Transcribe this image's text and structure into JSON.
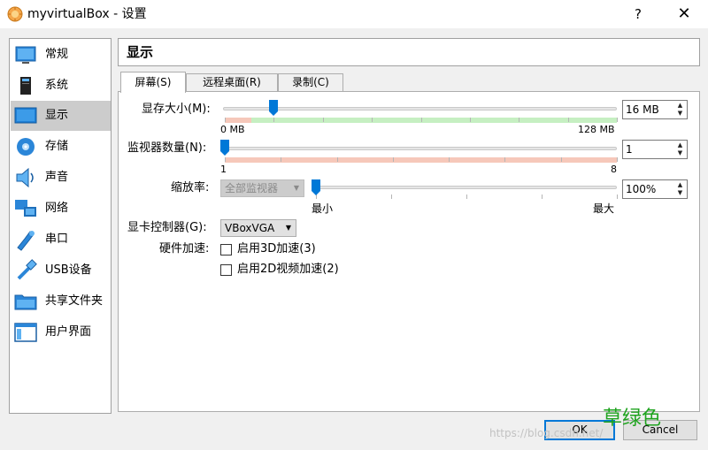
{
  "window": {
    "title": "myvirtualBox - 设置",
    "help_label": "?",
    "close_label": "✕"
  },
  "sidebar": {
    "items": [
      {
        "label": "常规",
        "icon": "general-icon"
      },
      {
        "label": "系统",
        "icon": "system-icon"
      },
      {
        "label": "显示",
        "icon": "display-icon",
        "active": true
      },
      {
        "label": "存储",
        "icon": "storage-icon"
      },
      {
        "label": "声音",
        "icon": "audio-icon"
      },
      {
        "label": "网络",
        "icon": "network-icon"
      },
      {
        "label": "串口",
        "icon": "serial-port-icon"
      },
      {
        "label": "USB设备",
        "icon": "usb-icon"
      },
      {
        "label": "共享文件夹",
        "icon": "shared-folder-icon"
      },
      {
        "label": "用户界面",
        "icon": "user-interface-icon"
      }
    ]
  },
  "section": {
    "title": "显示"
  },
  "tabs": [
    {
      "label": "屏幕(S)",
      "active": true
    },
    {
      "label": "远程桌面(R)",
      "active": false
    },
    {
      "label": "录制(C)",
      "active": false
    }
  ],
  "screen": {
    "video_memory": {
      "label": "显存大小(M):",
      "min_label": "0 MB",
      "max_label": "128 MB",
      "value": "16 MB",
      "slider_value": 16,
      "slider_max": 128
    },
    "monitor_count": {
      "label": "监视器数量(N):",
      "min_label": "1",
      "max_label": "8",
      "value": "1",
      "slider_value": 1,
      "slider_min": 1,
      "slider_max": 8
    },
    "scale_factor": {
      "label": "缩放率:",
      "monitor_select": "全部监视器",
      "min_label": "最小",
      "max_label": "最大",
      "value": "100%"
    },
    "graphics_controller": {
      "label": "显卡控制器(G):",
      "value": "VBoxVGA"
    },
    "acceleration": {
      "label": "硬件加速:",
      "enable_3d": {
        "label": "启用3D加速(3)",
        "checked": false
      },
      "enable_2d": {
        "label": "启用2D视频加速(2)",
        "checked": false
      }
    }
  },
  "footer": {
    "ok_label": "OK",
    "cancel_label": "Cancel"
  },
  "overlay": {
    "watermark_url": "https://blog.csdn.net/",
    "watermark_tag": "草绿色"
  },
  "colors": {
    "accent": "#0078d7",
    "slider_red_zone": "#f6c8ba",
    "slider_green_zone": "#c6efc2",
    "active_sidebar": "#cccccc"
  }
}
